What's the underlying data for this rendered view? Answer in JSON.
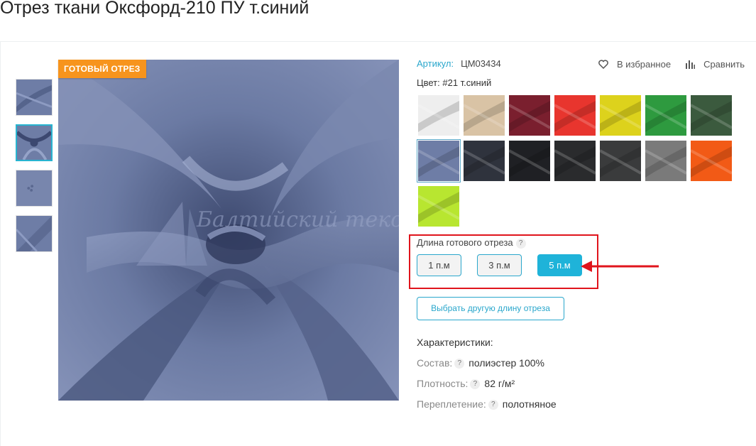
{
  "title": "Отрез ткани Оксфорд-210 ПУ т.синий",
  "badge": "ГОТОВЫЙ ОТРЕЗ",
  "watermark": "Балтийский текстиль",
  "sku": {
    "label": "Артикул:",
    "value": "ЦМ03434"
  },
  "actions": {
    "favorite": "В избранное",
    "compare": "Сравнить"
  },
  "color": {
    "text": "Цвет: #21 т.синий"
  },
  "swatch_colors": [
    "#eeeeee",
    "#d9c3a5",
    "#7a1f2e",
    "#e8352e",
    "#ddd21c",
    "#2e9a3f",
    "#3b5a3e",
    "#6e7da6",
    "#2f333d",
    "#1f2024",
    "#2a2b2d",
    "#3a3b3c",
    "#7a7a7a",
    "#f25a16",
    "#b8e630"
  ],
  "selected_swatch": 7,
  "length": {
    "title": "Длина готового отреза",
    "help": "?",
    "options": [
      "1 п.м",
      "3 п.м",
      "5 п.м"
    ],
    "active": "5 п.м"
  },
  "other_length": "Выбрать другую длину отреза",
  "characteristics": {
    "title": "Характеристики:",
    "rows": [
      {
        "label": "Состав:",
        "value": "полиэстер 100%"
      },
      {
        "label": "Плотность:",
        "value": "82 г/м²"
      },
      {
        "label": "Переплетение:",
        "value": "полотняное"
      }
    ]
  },
  "colors": {
    "accent": "#2aa7cc",
    "badge": "#f7941d",
    "highlight": "#e0141c",
    "fabric": "#6e7da6"
  }
}
